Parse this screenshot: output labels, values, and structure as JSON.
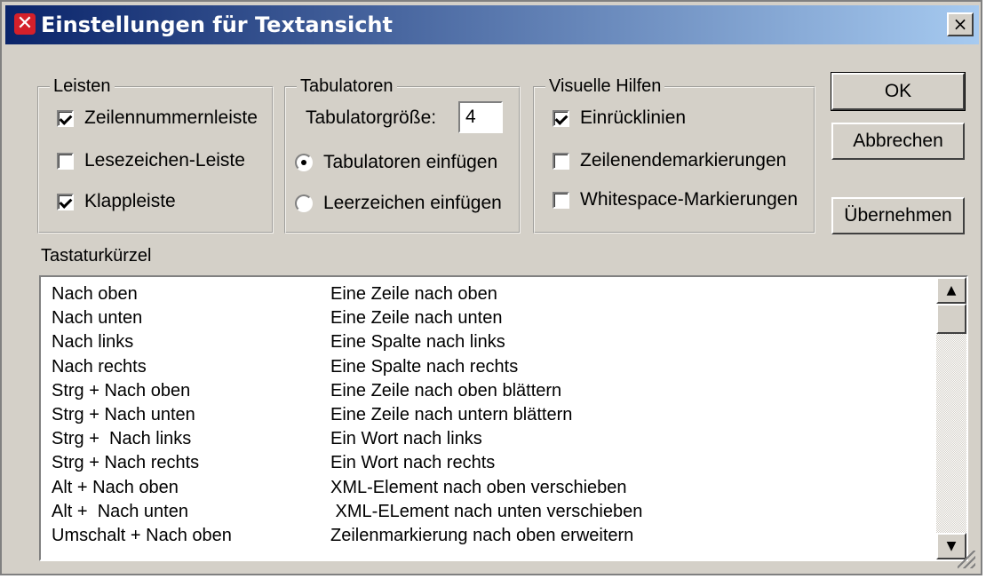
{
  "window": {
    "title": "Einstellungen für Textansicht",
    "close_label": "×"
  },
  "groups": {
    "leisten": {
      "label": "Leisten",
      "items": [
        {
          "label": "Zeilennummernleiste",
          "checked": true
        },
        {
          "label": "Lesezeichen-Leiste",
          "checked": false
        },
        {
          "label": "Klappleiste",
          "checked": true
        }
      ]
    },
    "tabulatoren": {
      "label": "Tabulatoren",
      "size_label": "Tabulatorgröße:",
      "size_value": "4",
      "options": [
        {
          "label": "Tabulatoren einfügen",
          "selected": true
        },
        {
          "label": "Leerzeichen einfügen",
          "selected": false
        }
      ]
    },
    "visuelle": {
      "label": "Visuelle Hilfen",
      "items": [
        {
          "label": "Einrücklinien",
          "checked": true
        },
        {
          "label": "Zeilenendemarkierungen",
          "checked": false
        },
        {
          "label": "Whitespace-Markierungen",
          "checked": false
        }
      ]
    }
  },
  "buttons": {
    "ok": "OK",
    "cancel": "Abbrechen",
    "apply": "Übernehmen"
  },
  "shortcuts": {
    "label": "Tastaturkürzel",
    "rows": [
      {
        "key": "Nach oben",
        "desc": "Eine Zeile nach oben"
      },
      {
        "key": "Nach unten",
        "desc": "Eine Zeile nach unten"
      },
      {
        "key": "Nach links",
        "desc": "Eine Spalte nach links"
      },
      {
        "key": "Nach rechts",
        "desc": "Eine Spalte nach rechts"
      },
      {
        "key": "Strg + Nach oben",
        "desc": "Eine Zeile nach oben blättern"
      },
      {
        "key": "Strg + Nach unten",
        "desc": "Eine Zeile nach untern blättern"
      },
      {
        "key": "Strg +  Nach links",
        "desc": "Ein Wort nach links"
      },
      {
        "key": "Strg + Nach rechts",
        "desc": "Ein Wort nach rechts"
      },
      {
        "key": "Alt + Nach oben",
        "desc": "XML-Element nach oben verschieben"
      },
      {
        "key": "Alt +  Nach unten",
        "desc": " XML-ELement nach unten verschieben"
      },
      {
        "key": "Umschalt + Nach oben",
        "desc": "Zeilenmarkierung nach oben erweitern"
      }
    ]
  },
  "colors": {
    "title_start": "#0a246a",
    "title_end": "#a6caf0",
    "face": "#d4d0c8"
  }
}
